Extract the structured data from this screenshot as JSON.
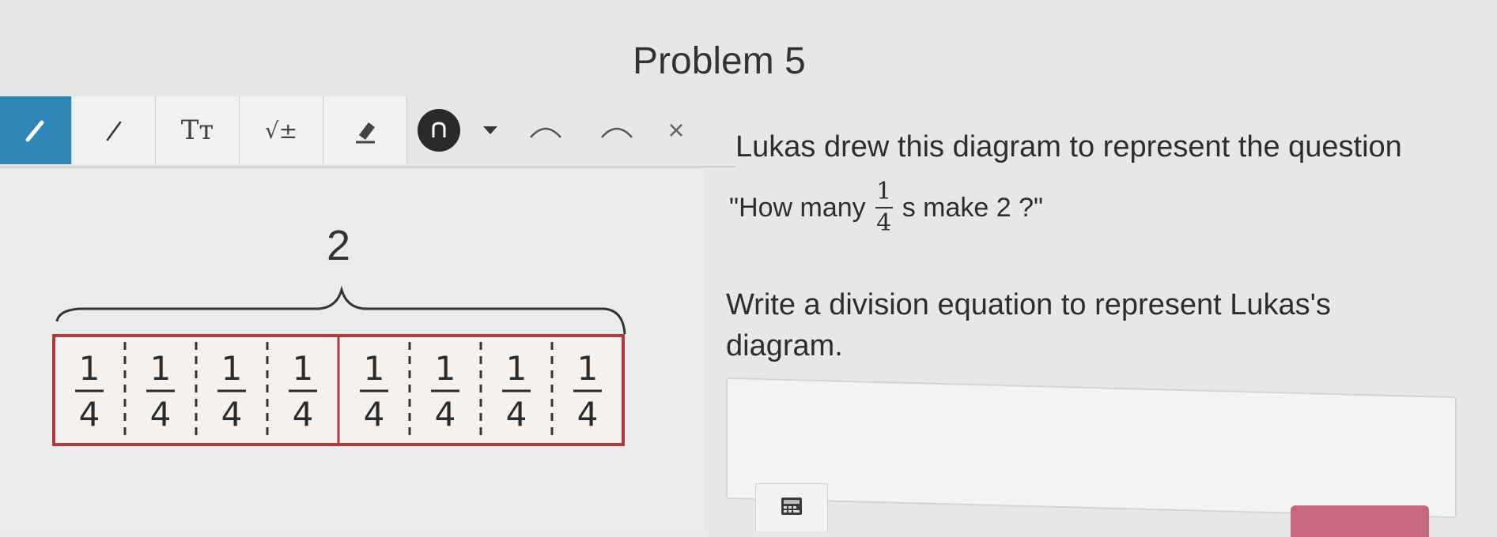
{
  "header": {
    "title": "Problem 5"
  },
  "toolbar": {
    "tools": [
      {
        "name": "pencil-icon"
      },
      {
        "name": "line-icon"
      },
      {
        "name": "text-icon",
        "label": "Tт"
      },
      {
        "name": "math-icon",
        "label": "√±"
      },
      {
        "name": "eraser-icon"
      },
      {
        "name": "undo-icon"
      },
      {
        "name": "dropdown-icon"
      },
      {
        "name": "arc-icon"
      },
      {
        "name": "arc-icon"
      },
      {
        "name": "close-icon",
        "label": "×"
      }
    ],
    "active_color": "#2f86b8"
  },
  "canvas": {
    "whole_label": "2",
    "pieces": [
      {
        "num": "1",
        "den": "4"
      },
      {
        "num": "1",
        "den": "4"
      },
      {
        "num": "1",
        "den": "4"
      },
      {
        "num": "1",
        "den": "4"
      },
      {
        "num": "1",
        "den": "4"
      },
      {
        "num": "1",
        "den": "4"
      },
      {
        "num": "1",
        "den": "4"
      },
      {
        "num": "1",
        "den": "4"
      }
    ],
    "box_color": "#b03a3a"
  },
  "question": {
    "line1": "Lukas drew this diagram to represent the question",
    "line2_pre": "\"How many",
    "frac_num": "1",
    "frac_den": "4",
    "line2_post": "s make  2 ?\"",
    "prompt": "Write a division equation to represent Lukas's diagram."
  },
  "answer": {
    "value": ""
  },
  "icons": {
    "keypad": "keypad-icon"
  },
  "submit": {
    "color": "#c8687c"
  }
}
